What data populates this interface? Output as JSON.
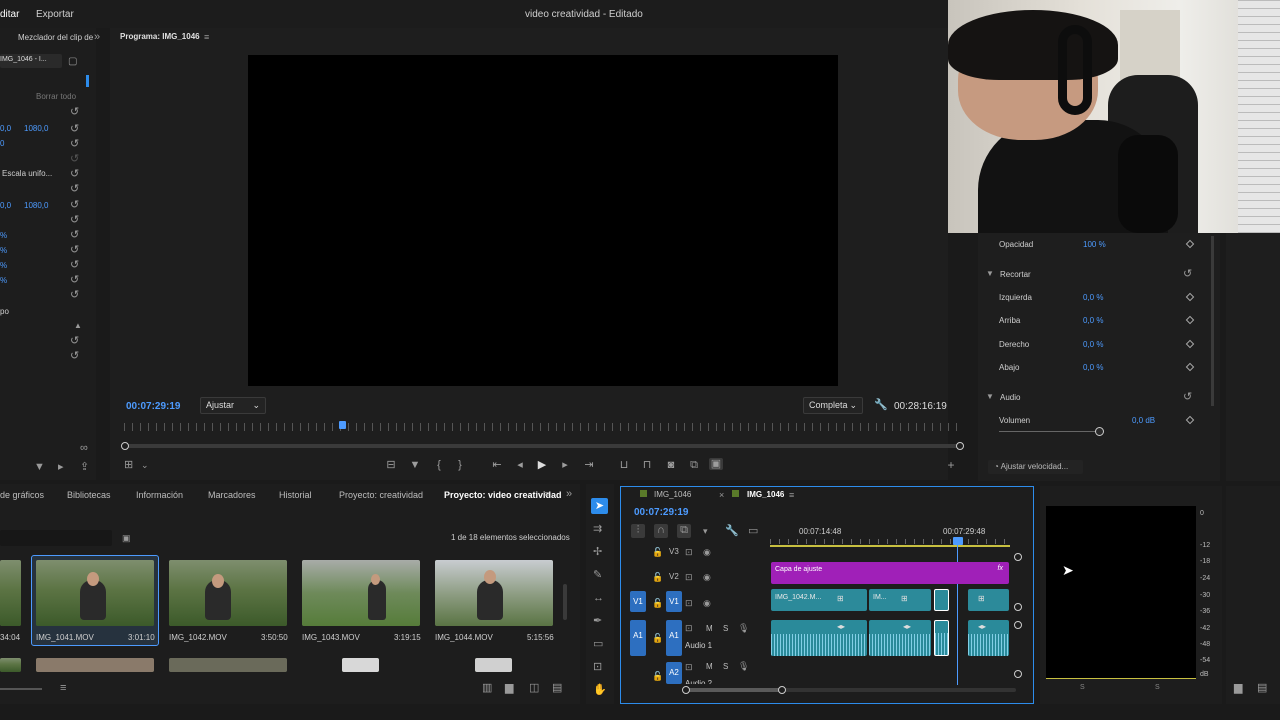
{
  "app": {
    "menu": [
      "ditar",
      "Exportar"
    ],
    "title": "video creatividad",
    "title_status": " - Editado"
  },
  "source_panel": {
    "tab_label": "Mezclador del clip de",
    "clip_tab": "IMG_1046 - I...",
    "clear_all": "Borrar todo",
    "scale_uniform": "Escala unifo...",
    "values": [
      "0,0",
      "1080,0",
      "0",
      "0,0",
      "1080,0"
    ],
    "pct_labels": [
      "%",
      "%",
      "%",
      "%",
      "%"
    ],
    "time_label": "po"
  },
  "program": {
    "tab_label": "Programa: IMG_1046",
    "timecode_left": "00:07:29:19",
    "fit_select": "Ajustar",
    "quality_select": "Completa",
    "timecode_right": "00:28:16:19"
  },
  "effects": {
    "opacity_label": "Opacidad",
    "opacity_value": "100 %",
    "crop_label": "Recortar",
    "crop_rows": [
      {
        "label": "Izquierda",
        "value": "0,0 %"
      },
      {
        "label": "Arriba",
        "value": "0,0 %"
      },
      {
        "label": "Derecho",
        "value": "0,0 %"
      },
      {
        "label": "Abajo",
        "value": "0,0 %"
      }
    ],
    "audio_label": "Audio",
    "volume_label": "Volumen",
    "volume_value": "0,0 dB",
    "speed_label": "Ajustar velocidad..."
  },
  "bottom_tabs": [
    "de gráficos",
    "Bibliotecas",
    "Información",
    "Marcadores",
    "Historial",
    "Proyecto: creatividad",
    "Proyecto: video creatividad"
  ],
  "project": {
    "selection_count": "1 de 18 elementos seleccionados",
    "items": [
      {
        "name": "",
        "duration": "34:04"
      },
      {
        "name": "IMG_1041.MOV",
        "duration": "3:01:10"
      },
      {
        "name": "IMG_1042.MOV",
        "duration": "3:50:50"
      },
      {
        "name": "IMG_1043.MOV",
        "duration": "3:19:15"
      },
      {
        "name": "IMG_1044.MOV",
        "duration": "5:15:56"
      }
    ]
  },
  "timeline": {
    "tabs": [
      "IMG_1046",
      "IMG_1046"
    ],
    "timecode": "00:07:29:19",
    "ruler": [
      "00:07:14:48",
      "00:07:29:48"
    ],
    "tracks": {
      "v3": "V3",
      "v2": "V2",
      "v1": "V1",
      "a1": "A1",
      "a2": "A2",
      "v1_src": "V1",
      "a1_src": "A1",
      "m": "M",
      "s": "S"
    },
    "adjustment_layer": "Capa de ajuste",
    "clip1": "IMG_1042.M...",
    "clip2": "IM...",
    "audio1": "Audio 1",
    "audio2": "Audio 2",
    "fx": "fx"
  },
  "meter": {
    "ticks": [
      "0",
      "-12",
      "-18",
      "-24",
      "-30",
      "-36",
      "-42",
      "-48",
      "-54",
      "dB"
    ],
    "s_labels": [
      "S",
      "S"
    ]
  },
  "colors": {
    "accent": "#2d8ceb",
    "timecode": "#4d9bff",
    "adjustment": "#a020b8",
    "clip": "#2c8a9a"
  }
}
